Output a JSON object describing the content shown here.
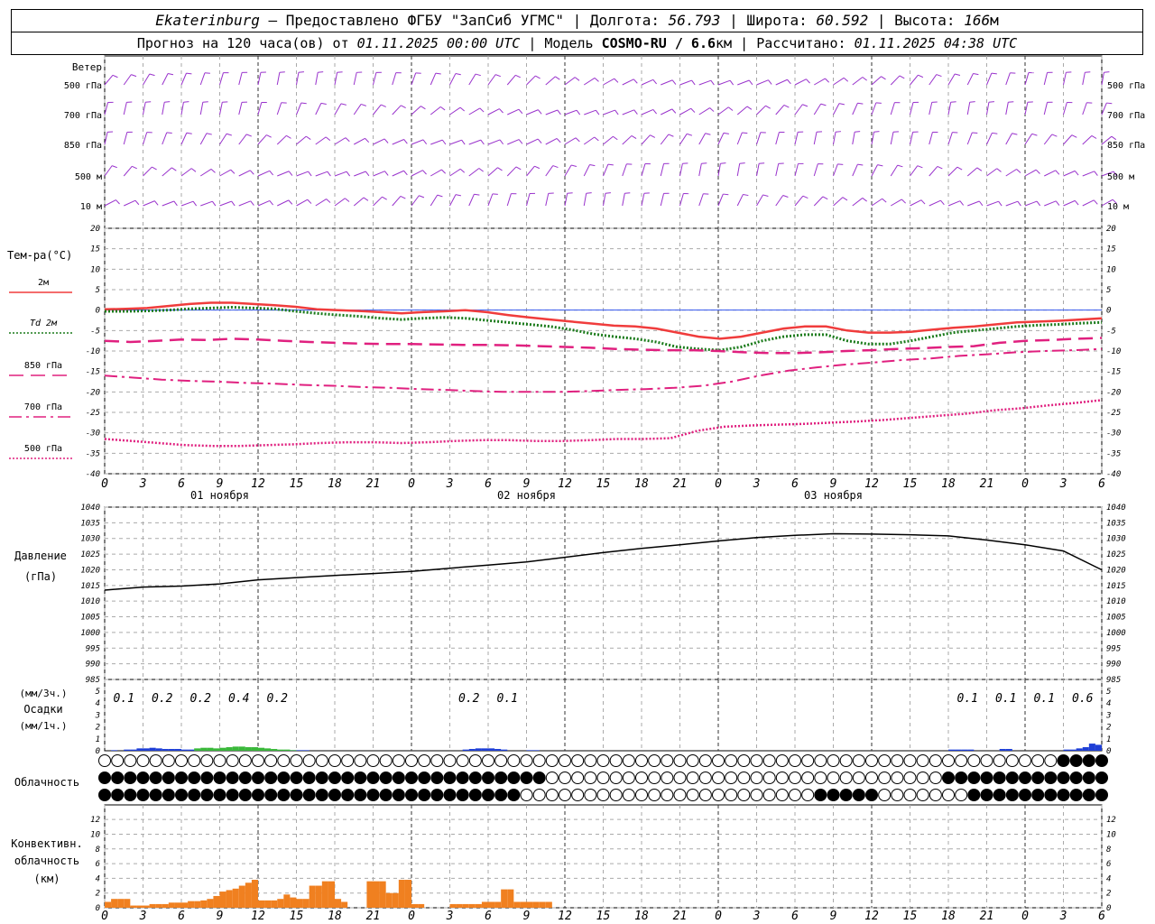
{
  "header": {
    "station": "Ekaterinburg",
    "provider": "Предоставлено ФГБУ \"ЗапСиб УГМС\"",
    "lon_label": "Долгота:",
    "lon_value": "56.793",
    "lat_label": "Широта:",
    "lat_value": "60.592",
    "alt_label": "Высота:",
    "alt_value": "166",
    "alt_unit": "м",
    "forecast_label": "Прогноз на 120 часа(ов) от",
    "forecast_start": "01.11.2025 00:00 UTC",
    "model_label": "Модель",
    "model_name": "COSMO-RU / 6.6",
    "model_unit": "км",
    "computed_label": "Рассчитано:",
    "computed_at": "01.11.2025 04:38 UTC"
  },
  "colors": {
    "t2m": "#f03c3c",
    "td2m": "#1a7a1a",
    "t850": "#e0207f",
    "t700": "#e0207f",
    "t500": "#e0207f",
    "wind": "#9933cc",
    "pressure": "#000000",
    "precip_blue": "#1f3fd6",
    "precip_green": "#3ab83a",
    "convective": "#f08020",
    "zero_line": "#3355ee"
  },
  "x_axis": {
    "tick_hours": [
      0,
      3,
      6,
      9,
      12,
      15,
      18,
      21,
      0,
      3,
      6,
      9,
      12,
      15,
      18,
      21,
      0,
      3,
      6,
      9,
      12,
      15,
      18,
      21,
      0,
      3,
      6
    ],
    "date_labels": [
      "01 ноября",
      "02 ноября",
      "03 ноября"
    ]
  },
  "wind": {
    "section_label": "Ветер",
    "levels": [
      "500 гПа",
      "700 гПа",
      "850 гПа",
      "500  м",
      "10  м"
    ],
    "right_levels": [
      "500 гПа",
      "700 гПа",
      "850 гПа",
      "500  м",
      "10  м"
    ]
  },
  "temperature": {
    "title": "Тем-ра(°C)",
    "legend": [
      "2м",
      "Td 2м",
      "850 гПа",
      "700 гПа",
      "500 гПа"
    ],
    "ylim": [
      -40,
      20
    ],
    "yticks": [
      20,
      15,
      10,
      5,
      0,
      -5,
      -10,
      -15,
      -20,
      -25,
      -30,
      -35,
      -40
    ]
  },
  "pressure": {
    "title": "Давление",
    "unit": "(гПа)",
    "ylim": [
      985,
      1040
    ],
    "yticks": [
      1040,
      1035,
      1030,
      1025,
      1020,
      1015,
      1010,
      1005,
      1000,
      995,
      990,
      985
    ]
  },
  "precip": {
    "unit_top": "(мм/3ч.)",
    "title": "Осадки",
    "unit_bottom": "(мм/1ч.)",
    "yticks": [
      5,
      4,
      3,
      2,
      1,
      0
    ],
    "totals": [
      {
        "hour": 3,
        "text": "0.1"
      },
      {
        "hour": 9,
        "text": "0.2"
      },
      {
        "hour": 15,
        "text": "0.2"
      },
      {
        "hour": 21,
        "text": "0.4"
      },
      {
        "hour": 27,
        "text": "0.2"
      },
      {
        "hour": 57,
        "text": "0.2"
      },
      {
        "hour": 63,
        "text": "0.1"
      },
      {
        "hour": 135,
        "text": "0.1"
      },
      {
        "hour": 141,
        "text": "0.1"
      },
      {
        "hour": 147,
        "text": "0.1"
      },
      {
        "hour": 153,
        "text": "0.6"
      }
    ]
  },
  "cloud": {
    "title": "Облачность"
  },
  "convective": {
    "title_1": "Конвективн.",
    "title_2": "облачность",
    "unit": "(км)",
    "yticks": [
      12,
      10,
      8,
      6,
      4,
      2,
      0
    ]
  },
  "chart_data": [
    {
      "type": "line",
      "title": "Тем-ра(°C)",
      "x_hours": [
        0,
        3,
        6,
        9,
        12,
        15,
        18,
        21,
        24,
        27,
        30,
        33,
        36,
        39,
        42,
        45,
        48,
        51,
        54,
        57,
        60,
        63,
        66,
        69,
        72,
        75,
        78,
        81,
        84,
        87,
        90,
        93,
        96,
        99,
        102,
        105,
        108,
        111,
        114,
        117,
        120,
        123,
        126,
        129,
        132,
        135,
        138,
        141,
        144,
        147,
        150,
        153,
        156
      ],
      "series": [
        {
          "name": "2м",
          "values": [
            0.2,
            0.3,
            0.5,
            1.0,
            1.5,
            1.8,
            1.8,
            1.5,
            1.2,
            0.8,
            0.2,
            0,
            -0.2,
            -0.5,
            -0.8,
            -0.5,
            -0.3,
            0,
            -0.5,
            -1.2,
            -1.8,
            -2.3,
            -2.8,
            -3.3,
            -3.8,
            -4.0,
            -4.5,
            -5.5,
            -6.5,
            -7.0,
            -6.5,
            -5.5,
            -4.5,
            -4.0,
            -4.0,
            -5.0,
            -5.5,
            -5.5,
            -5.3,
            -4.8,
            -4.3,
            -4.0,
            -3.5,
            -3.0,
            -2.8,
            -2.6,
            -2.3,
            -2.0
          ]
        },
        {
          "name": "Td 2м",
          "values": [
            -0.3,
            -0.3,
            -0.2,
            0,
            0.3,
            0.5,
            0.7,
            0.5,
            0.3,
            -0.3,
            -0.8,
            -1.2,
            -1.5,
            -2.0,
            -2.3,
            -2.0,
            -1.8,
            -2.0,
            -2.5,
            -3.0,
            -3.5,
            -4.0,
            -4.8,
            -5.8,
            -6.5,
            -7.0,
            -7.8,
            -9.0,
            -9.5,
            -9.8,
            -9.0,
            -7.5,
            -6.5,
            -6.0,
            -6.0,
            -7.5,
            -8.3,
            -8.3,
            -7.5,
            -6.5,
            -5.5,
            -5.0,
            -4.5,
            -4.0,
            -3.7,
            -3.5,
            -3.2,
            -3.0
          ]
        },
        {
          "name": "850 гПа",
          "values": [
            -7.5,
            -7.8,
            -7.5,
            -7.2,
            -7.3,
            -7.0,
            -7.2,
            -7.5,
            -7.8,
            -8.0,
            -8.2,
            -8.3,
            -8.3,
            -8.4,
            -8.5,
            -8.5,
            -8.6,
            -8.8,
            -9.0,
            -9.2,
            -9.5,
            -9.7,
            -9.8,
            -9.8,
            -10.0,
            -10.3,
            -10.5,
            -10.5,
            -10.3,
            -10.0,
            -9.8,
            -9.5,
            -9.3,
            -9.0,
            -8.8,
            -8.0,
            -7.5,
            -7.3,
            -7.0,
            -6.8
          ]
        },
        {
          "name": "700 гПа",
          "values": [
            -16.0,
            -16.5,
            -17.0,
            -17.3,
            -17.5,
            -17.8,
            -18.0,
            -18.3,
            -18.5,
            -18.8,
            -19.0,
            -19.3,
            -19.5,
            -19.8,
            -20.0,
            -20.0,
            -20.0,
            -19.8,
            -19.5,
            -19.3,
            -19.0,
            -18.5,
            -17.5,
            -16.0,
            -14.8,
            -14.0,
            -13.3,
            -12.8,
            -12.2,
            -11.8,
            -11.2,
            -10.8,
            -10.3,
            -10.0,
            -9.8,
            -9.5
          ]
        },
        {
          "name": "500 гПа",
          "values": [
            -31.5,
            -32.0,
            -32.5,
            -33.0,
            -33.2,
            -33.2,
            -33.0,
            -32.8,
            -32.5,
            -32.3,
            -32.3,
            -32.5,
            -32.3,
            -32.0,
            -31.8,
            -31.8,
            -32.0,
            -32.0,
            -31.8,
            -31.5,
            -31.5,
            -31.3,
            -29.5,
            -28.5,
            -28.2,
            -28.0,
            -27.8,
            -27.5,
            -27.2,
            -26.8,
            -26.3,
            -25.8,
            -25.3,
            -24.5,
            -24.0,
            -23.3,
            -22.7,
            -22.0
          ]
        }
      ],
      "ylim": [
        -40,
        20
      ]
    },
    {
      "type": "line",
      "title": "Давление",
      "ylabel": "(гПа)",
      "x_hours": [
        0,
        6,
        12,
        18,
        24,
        30,
        36,
        42,
        48,
        54,
        60,
        66,
        72,
        78,
        84,
        90,
        96,
        102,
        108,
        114,
        120,
        126,
        132,
        138,
        144,
        150,
        156
      ],
      "series": [
        {
          "name": "Давление",
          "values": [
            1013.5,
            1014.5,
            1014.8,
            1015.5,
            1016.8,
            1017.5,
            1018.2,
            1018.8,
            1019.5,
            1020.5,
            1021.5,
            1022.5,
            1024.0,
            1025.5,
            1026.8,
            1028.0,
            1029.2,
            1030.3,
            1031.0,
            1031.5,
            1031.4,
            1031.2,
            1030.8,
            1029.5,
            1028.0,
            1026.0,
            1020.0
          ]
        }
      ],
      "ylim": [
        985,
        1040
      ]
    },
    {
      "type": "bar",
      "title": "Осадки",
      "x_hours": [
        2,
        4,
        5,
        6,
        7,
        8,
        9,
        10,
        11,
        12,
        13,
        14,
        15,
        16,
        17,
        18,
        19,
        20,
        21,
        22,
        23,
        24,
        25,
        26,
        27,
        28,
        29,
        30,
        31,
        32,
        57,
        58,
        59,
        60,
        61,
        62,
        63,
        67,
        68,
        133,
        134,
        135,
        136,
        141,
        142,
        151,
        152,
        153,
        154,
        155,
        156
      ],
      "series": [
        {
          "name": "blue",
          "values": [
            0.05,
            0.1,
            0.1,
            0.2,
            0.2,
            0.25,
            0.2,
            0.15,
            0.15,
            0.15,
            0.1,
            0.1,
            0.1,
            0.1,
            0.1,
            0.1,
            0.1,
            0.1,
            0.1,
            0.1,
            0.1,
            0.1,
            0.1,
            0.1,
            0.1,
            0.05,
            0.05,
            0.05,
            0.05,
            0.05,
            0.1,
            0.15,
            0.2,
            0.2,
            0.2,
            0.15,
            0.1,
            0.05,
            0.05,
            0.1,
            0.1,
            0.1,
            0.1,
            0.15,
            0.15,
            0.1,
            0.1,
            0.2,
            0.3,
            0.6,
            0.5
          ]
        },
        {
          "name": "green",
          "values": [
            0,
            0,
            0,
            0,
            0,
            0,
            0,
            0,
            0,
            0,
            0,
            0,
            0.2,
            0.25,
            0.25,
            0.2,
            0.25,
            0.3,
            0.35,
            0.35,
            0.3,
            0.3,
            0.25,
            0.2,
            0.15,
            0.1,
            0.1,
            0.05,
            0,
            0,
            0,
            0,
            0,
            0,
            0,
            0,
            0,
            0,
            0,
            0,
            0,
            0,
            0,
            0,
            0,
            0,
            0,
            0,
            0,
            0,
            0
          ]
        }
      ]
    },
    {
      "type": "bar",
      "title": "Конвективн. облачность",
      "ylabel": "(км)",
      "x_hours": [
        0,
        1,
        2,
        3,
        4,
        5,
        6,
        7,
        8,
        9,
        10,
        11,
        12,
        13,
        14,
        15,
        16,
        17,
        18,
        19,
        20,
        21,
        22,
        23,
        24,
        25,
        26,
        27,
        28,
        29,
        30,
        31,
        32,
        33,
        34,
        35,
        36,
        37,
        38,
        39,
        40,
        41,
        42,
        43,
        44,
        45,
        46,
        47,
        48,
        49,
        50,
        51,
        52,
        53,
        54,
        55,
        56,
        57,
        58,
        59,
        60,
        61,
        62,
        63,
        64,
        65,
        66,
        67,
        68,
        69,
        70,
        71,
        72,
        73,
        74,
        75,
        76,
        77,
        78,
        79
      ],
      "series": [
        {
          "name": "top_km",
          "values": [
            0.8,
            1.2,
            1.2,
            1.2,
            0.3,
            0.3,
            0.3,
            0.5,
            0.5,
            0.5,
            0.7,
            0.7,
            0.7,
            0.9,
            0.9,
            1.0,
            1.2,
            1.6,
            2.2,
            2.4,
            2.6,
            3.0,
            3.4,
            3.8,
            1.0,
            1.0,
            1.0,
            1.2,
            1.8,
            1.4,
            1.2,
            1.2,
            3.0,
            3.0,
            3.6,
            3.6,
            1.2,
            0.8,
            0,
            0,
            0,
            3.6,
            3.6,
            3.6,
            2.0,
            2.0,
            3.8,
            3.8,
            0.5,
            0.5,
            0,
            0,
            0,
            0,
            0.5,
            0.5,
            0.5,
            0.5,
            0.5,
            0.8,
            0.8,
            0.8,
            2.5,
            2.5,
            0.8,
            0.8,
            0.8,
            0.8,
            0.8,
            0.8,
            0,
            0,
            0,
            0,
            0,
            0,
            0,
            0,
            0,
            0
          ]
        }
      ],
      "ylim": [
        0,
        13
      ]
    }
  ]
}
